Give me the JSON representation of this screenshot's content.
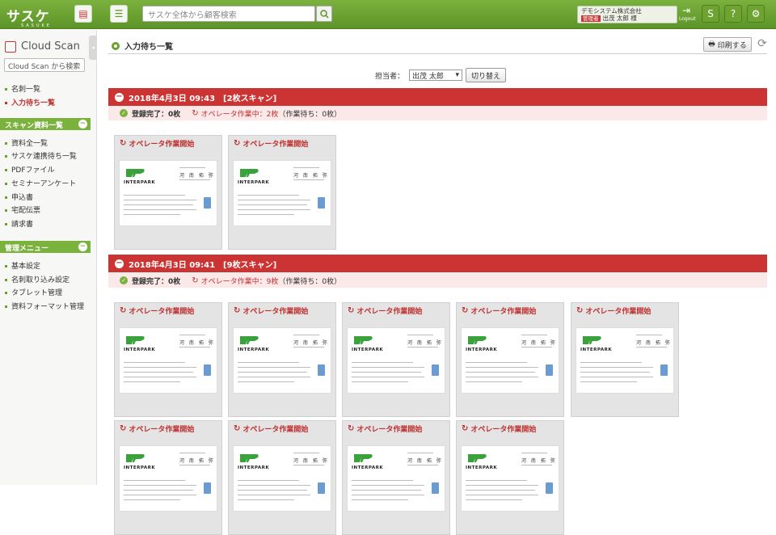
{
  "header": {
    "logo_text": "サスケ",
    "logo_sub": "SASUKE",
    "search_placeholder": "サスケ全体から顧客検索",
    "user_company": "デモシステム株式会社",
    "user_badge": "管理者",
    "user_name": "出茂 太郎 様",
    "logout_label": "Logout"
  },
  "sidebar": {
    "app_title": "Cloud Scan",
    "search_placeholder": "Cloud Scan から検索",
    "top_items": [
      "名刺一覧",
      "入力待ち一覧"
    ],
    "active_item": "入力待ち一覧",
    "scan_section": "スキャン資料一覧",
    "scan_items": [
      "資料全一覧",
      "サスケ連携待ち一覧",
      "PDFファイル",
      "セミナーアンケート",
      "申込書",
      "宅配伝票",
      "請求書"
    ],
    "admin_section": "管理メニュー",
    "admin_items": [
      "基本設定",
      "名刺取り込み設定",
      "タブレット管理",
      "資料フォーマット管理"
    ]
  },
  "main": {
    "title": "入力待ち一覧",
    "print_label": "印刷する",
    "assignee_label": "担当者：",
    "assignee_value": "出茂 太郎",
    "switch_label": "切り替え",
    "card_action": "オペレータ作業開始",
    "card_logo_text": "INTERPARK",
    "card_person": "河 南 拓 弥",
    "batches": [
      {
        "title": "2018年4月3日 09:43　[2枚スキャン]",
        "done": "登録完了：0枚",
        "working": "オペレータ作業中：2枚",
        "waiting": "（作業待ち：0枚）",
        "card_count": 2
      },
      {
        "title": "2018年4月3日 09:41　[9枚スキャン]",
        "done": "登録完了：0枚",
        "working": "オペレータ作業中：9枚",
        "waiting": "（作業待ち：0枚）",
        "card_count": 9
      }
    ]
  },
  "colors": {
    "brand_green": "#7bb13d",
    "alert_red": "#cc3333"
  }
}
